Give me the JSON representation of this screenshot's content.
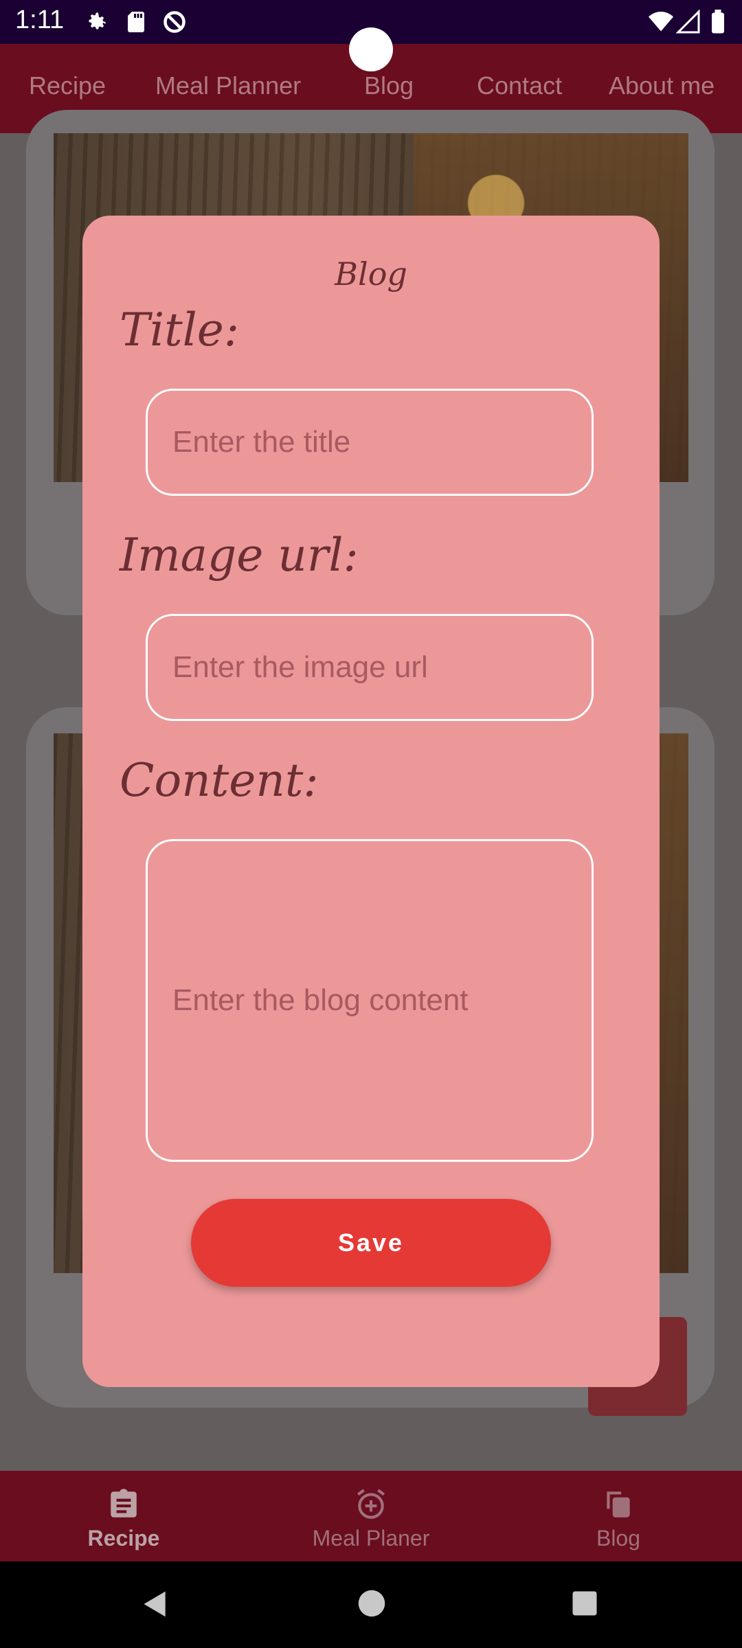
{
  "status_bar": {
    "time": "1:11"
  },
  "top_tabs": [
    {
      "label": "Recipe"
    },
    {
      "label": "Meal Planner"
    },
    {
      "label": "Blog"
    },
    {
      "label": "Contact"
    },
    {
      "label": "About me"
    }
  ],
  "dialog": {
    "title": "Blog",
    "title_label": "Title:",
    "title_placeholder": "Enter the title",
    "image_label": "Image url:",
    "image_placeholder": "Enter the image url",
    "content_label": "Content:",
    "content_placeholder": "Enter the blog content",
    "save_label": "Save"
  },
  "bottom_nav": [
    {
      "label": "Recipe",
      "icon": "clipboard-icon",
      "active": true
    },
    {
      "label": "Meal Planer",
      "icon": "alarm-add-icon",
      "active": false
    },
    {
      "label": "Blog",
      "icon": "copy-icon",
      "active": false
    }
  ],
  "colors": {
    "primary": "#6a0d1f",
    "dialog_bg": "#ec9899",
    "save_button": "#e53935"
  }
}
